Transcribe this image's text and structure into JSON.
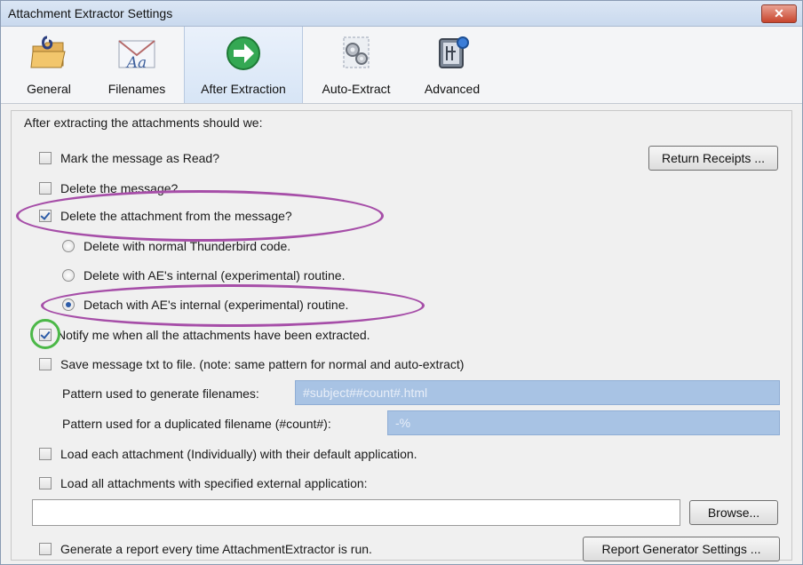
{
  "window": {
    "title": "Attachment Extractor Settings",
    "close_glyph": "✕"
  },
  "tabs": [
    {
      "label": "General",
      "icon": "folder-clip-icon"
    },
    {
      "label": "Filenames",
      "icon": "envelope-text-icon"
    },
    {
      "label": "After Extraction",
      "icon": "green-arrow-icon",
      "selected": true
    },
    {
      "label": "Auto-Extract",
      "icon": "gears-icon"
    },
    {
      "label": "Advanced",
      "icon": "advanced-device-icon"
    }
  ],
  "after_extraction": {
    "caption": "After extracting the attachments should we:",
    "mark_read": {
      "label": "Mark the message as Read?",
      "checked": false
    },
    "return_receipts": "Return Receipts ...",
    "delete_message": {
      "label": "Delete the message?",
      "checked": false
    },
    "delete_attachment": {
      "label": "Delete the attachment from the message?",
      "checked": true
    },
    "radio_normal": {
      "label": "Delete with normal Thunderbird code.",
      "checked": false
    },
    "radio_internal": {
      "label": "Delete with AE's internal (experimental) routine.",
      "checked": false
    },
    "radio_detach": {
      "label": "Detach with AE's internal (experimental) routine.",
      "checked": true
    },
    "notify": {
      "label": "Notify me when all the attachments have been extracted.",
      "checked": true
    },
    "save_txt": {
      "label": "Save message txt to file. (note: same pattern for normal and auto-extract)",
      "checked": false
    },
    "pattern_label": "Pattern used to generate filenames:",
    "pattern_value": "#subject##count#.html",
    "dup_label": "Pattern used for a duplicated filename (#count#):",
    "dup_value": "-%",
    "load_each": {
      "label": "Load each attachment (Individually) with their default application.",
      "checked": false
    },
    "load_all": {
      "label": "Load all attachments with specified external application:",
      "checked": false
    },
    "external_app_value": "",
    "browse": "Browse...",
    "report": {
      "label": "Generate a report every time AttachmentExtractor is run.",
      "checked": false
    },
    "report_settings": "Report Generator Settings ..."
  },
  "colors": {
    "annotation_oval": "#a64ea8",
    "annotation_circle": "#4cb848",
    "disabled_field": "#a8c3e4"
  }
}
